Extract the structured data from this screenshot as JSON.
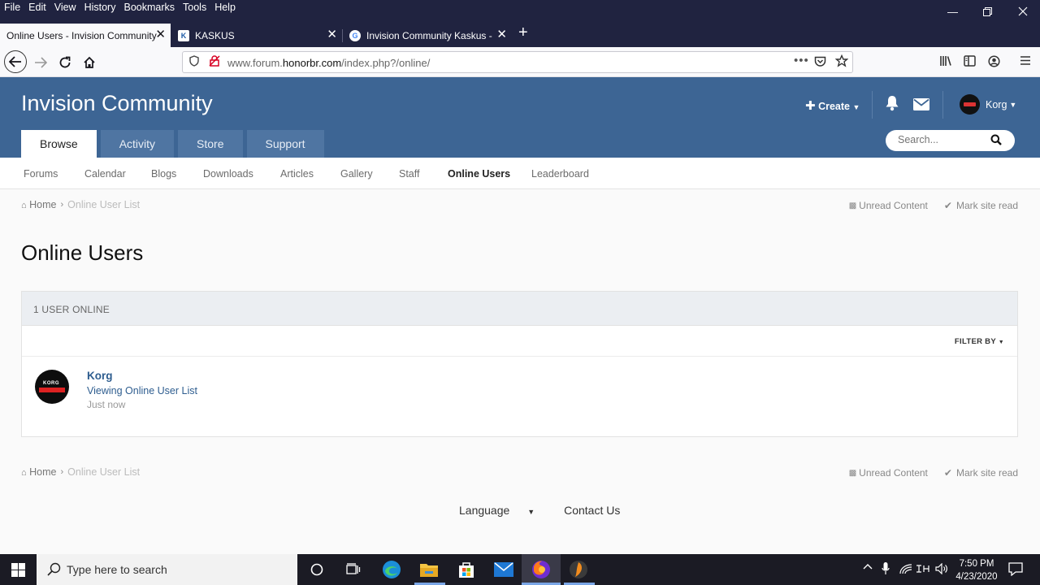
{
  "browser": {
    "menu": [
      "File",
      "Edit",
      "View",
      "History",
      "Bookmarks",
      "Tools",
      "Help"
    ],
    "tabs": [
      {
        "title": "Online Users - Invision Community",
        "active": true
      },
      {
        "title": "KASKUS",
        "active": false
      },
      {
        "title": "Invision Community Kaskus - G",
        "active": false
      }
    ],
    "url_prefix": "www.forum.",
    "url_domain": "honorbr.com",
    "url_path": "/index.php?/online/"
  },
  "site": {
    "title": "Invision Community",
    "create_label": "Create",
    "username": "Korg",
    "main_tabs": [
      "Browse",
      "Activity",
      "Store",
      "Support"
    ],
    "search_placeholder": "Search...",
    "subnav": [
      "Forums",
      "Calendar",
      "Blogs",
      "Downloads",
      "Articles",
      "Gallery",
      "Staff",
      "Online Users",
      "Leaderboard"
    ],
    "subnav_active": "Online Users"
  },
  "breadcrumb": {
    "home": "Home",
    "current": "Online User List",
    "unread": "Unread Content",
    "mark_read": "Mark site read"
  },
  "page": {
    "title": "Online Users",
    "count_label": "1 USER ONLINE",
    "filter_label": "FILTER BY",
    "avatar_text": "KORG",
    "users": [
      {
        "name": "Korg",
        "activity": "Viewing Online User List",
        "time": "Just now"
      }
    ]
  },
  "footer": {
    "language": "Language",
    "contact": "Contact Us"
  },
  "taskbar": {
    "search_placeholder": "Type here to search",
    "time": "7:50 PM",
    "date": "4/23/2020"
  },
  "colors": {
    "header": "#3d6594",
    "link": "#2e5d8f"
  }
}
